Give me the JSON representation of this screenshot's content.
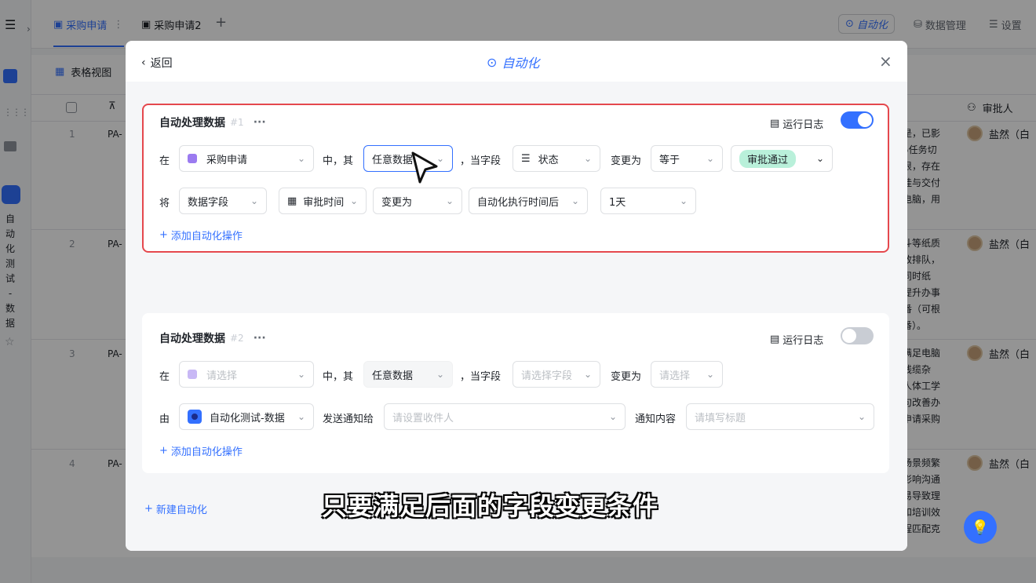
{
  "app": {
    "tabs": [
      {
        "label": "采购申请"
      },
      {
        "label": "采购申请2"
      }
    ],
    "add_tab": "+",
    "menu_icon": "☰",
    "top_right": {
      "automation": "自动化",
      "data_manage": "数据管理",
      "settings": "设置"
    },
    "view_label": "表格视图",
    "vertical_label": [
      "自",
      "动",
      "化",
      "测",
      "试",
      "-",
      "数",
      "据"
    ],
    "approver_header": "审批人",
    "rows": [
      {
        "num": "1",
        "pa": "PA-",
        "desc": "是，已影\n5任务切\n很，存在\n挂与交付\n电脑，用",
        "approver": "盐然（白"
      },
      {
        "num": "2",
        "pa": "PA-",
        "desc": "斗等纸质\n致排队，\n同时纸\n提升办事\n番（可根\n番）。",
        "approver": "盐然（白"
      },
      {
        "num": "3",
        "pa": "PA-",
        "desc": "满足电脑\n线缆杂\n人体工学\n句改善办\n申请采购",
        "approver": "盐然（白"
      },
      {
        "num": "4",
        "pa": "PA-",
        "desc": "场景频繁\n影响沟通\n易导致理\n和培训效\n程匹配克",
        "approver": "盐然（白"
      }
    ]
  },
  "modal": {
    "back_label": "返回",
    "title": "自动化",
    "close": "×",
    "cards": [
      {
        "title": "自动处理数据",
        "number": "#1",
        "more": "···",
        "run_log": "运行日志",
        "enabled": true,
        "row1": {
          "in_label": "在",
          "table": "采购申请",
          "mid_label": "中，其",
          "data_scope": "任意数据",
          "when_label": "，当字段",
          "field": "状态",
          "change_label": "变更为",
          "operator": "等于",
          "value_tag": "审批通过"
        },
        "row2": {
          "will_label": "将",
          "target": "数据字段",
          "date_field": "审批时间",
          "action": "变更为",
          "timing": "自动化执行时间后",
          "offset": "1天"
        },
        "add_action": "添加自动化操作"
      },
      {
        "title": "自动处理数据",
        "number": "#2",
        "more": "···",
        "run_log": "运行日志",
        "enabled": false,
        "row1": {
          "in_label": "在",
          "table_placeholder": "请选择",
          "mid_label": "中，其",
          "data_scope": "任意数据",
          "when_label": "，当字段",
          "field_placeholder": "请选择字段",
          "change_label": "变更为",
          "value_placeholder": "请选择"
        },
        "row2": {
          "by_label": "由",
          "source": "自动化测试-数据",
          "notify_label": "发送通知给",
          "recipient_placeholder": "请设置收件人",
          "content_label": "通知内容",
          "content_placeholder": "请填写标题"
        },
        "add_action": "添加自动化操作"
      }
    ],
    "new_automation": "新建自动化"
  },
  "subtitle": "只要满足后面的字段变更条件",
  "colors": {
    "accent": "#3370ff",
    "highlight_border": "#e5484d",
    "tag_bg": "#b9f0da"
  }
}
